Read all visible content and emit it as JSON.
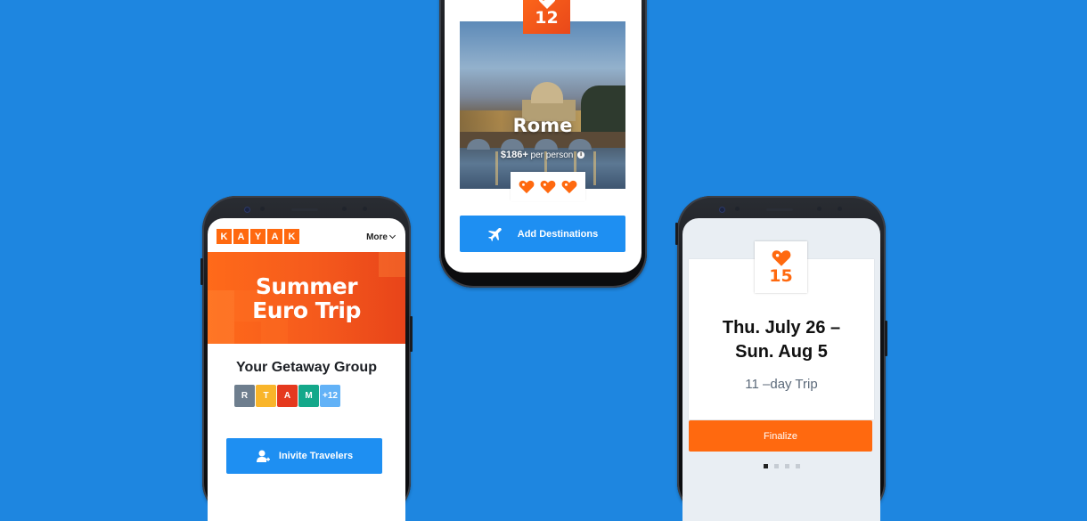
{
  "colors": {
    "background": "#1e86e0",
    "kayak_orange": "#ff690f",
    "button_blue": "#1e8ff2"
  },
  "phone_left": {
    "logo_letters": [
      "K",
      "A",
      "Y",
      "A",
      "K"
    ],
    "more_menu_label": "More",
    "hero_title_line1": "Summer",
    "hero_title_line2": "Euro Trip",
    "group_title": "Your Getaway Group",
    "avatars": [
      {
        "label": "R",
        "color": "#6e7e8e"
      },
      {
        "label": "T",
        "color": "#f9b52a"
      },
      {
        "label": "A",
        "color": "#e5391e"
      },
      {
        "label": "M",
        "color": "#14a88a"
      },
      {
        "label": "+12",
        "color": "#62b2f7"
      }
    ],
    "invite_button_label": "Inivite Travelers",
    "invite_button_icon": "add-user-icon"
  },
  "phone_middle": {
    "like_count": "12",
    "destination_name": "Rome",
    "price": "$186+",
    "price_suffix": "per person",
    "info_icon": "i",
    "hearts_count": 3,
    "add_button_label": "Add Destinations",
    "add_button_icon": "airplane-icon"
  },
  "phone_right": {
    "like_count": "15",
    "date_line1": "Thu. July 26 –",
    "date_line2": "Sun.  Aug 5",
    "trip_length": "11 –day Trip",
    "finalize_label": "Finalize",
    "pager_total": 4,
    "pager_active": 1
  }
}
